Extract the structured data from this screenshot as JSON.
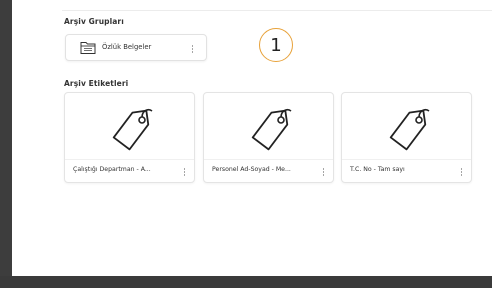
{
  "archive_groups": {
    "title": "Arşiv Grupları",
    "items": [
      {
        "label": "Özlük Belgeler",
        "icon": "folder-icon"
      }
    ]
  },
  "step_badge": "1",
  "archive_tags": {
    "title": "Arşiv Etiketleri",
    "items": [
      {
        "label": "Çalıştığı Departman - A...",
        "icon": "tag-icon"
      },
      {
        "label": "Personel Ad-Soyad - Me...",
        "icon": "tag-icon"
      },
      {
        "label": "T.C. No - Tam sayı",
        "icon": "tag-icon"
      }
    ]
  },
  "colors": {
    "badge_border": "#e8a23a",
    "frame": "#3d3d3d"
  }
}
